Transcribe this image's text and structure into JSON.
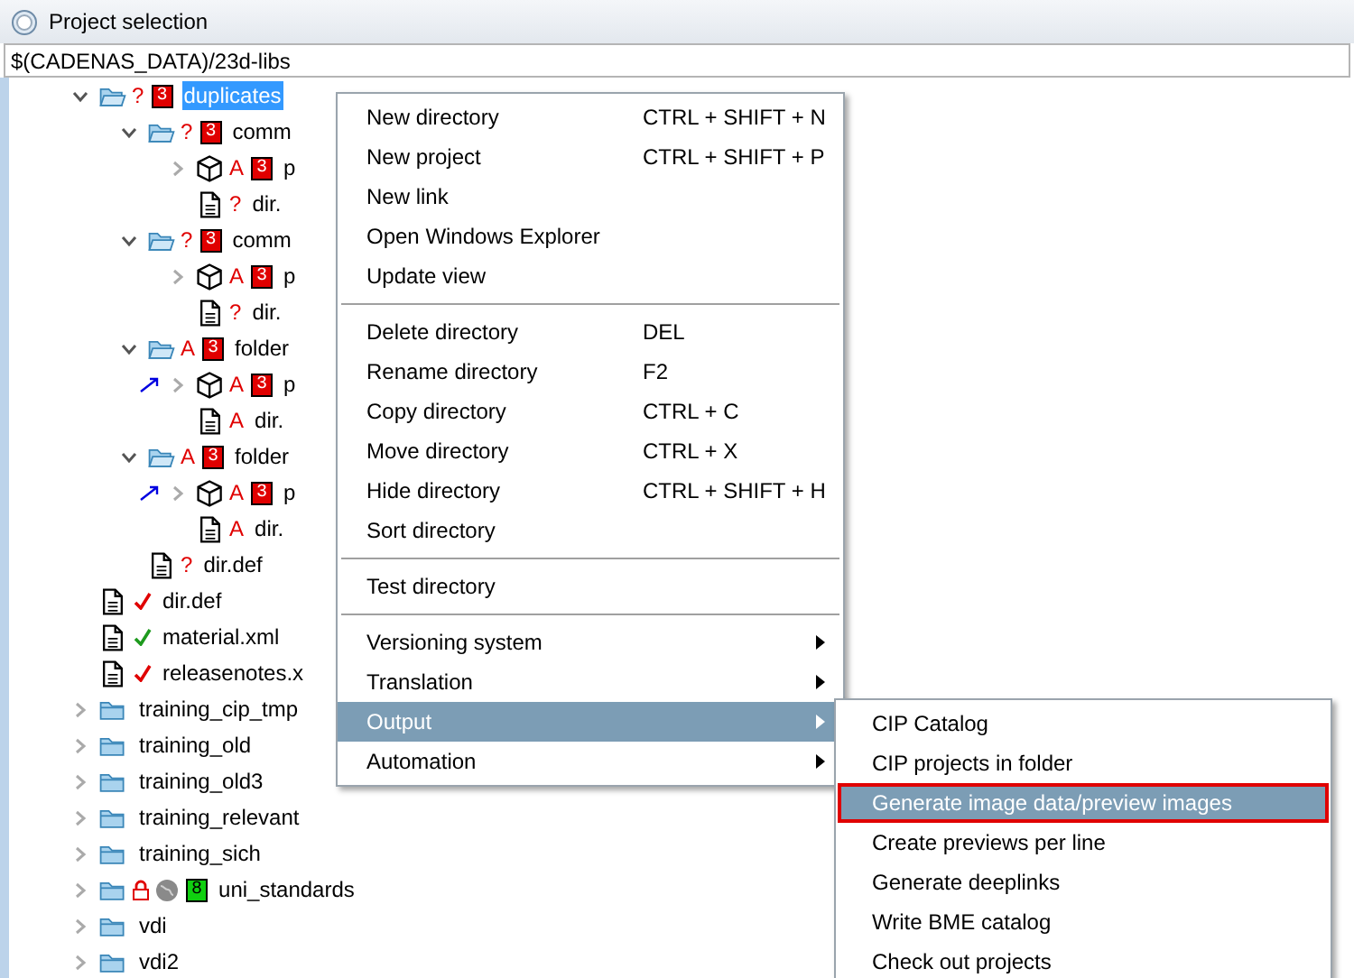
{
  "window": {
    "title": "Project selection"
  },
  "path_field": {
    "value": "$(CADENAS_DATA)/23d-libs"
  },
  "tree": [
    {
      "children": [
        {
          "label": "duplicates",
          "kind": "folder",
          "expanded": true,
          "selected": true,
          "marker": "?",
          "badge": {
            "text": "3",
            "color": "#e00000"
          },
          "children": [
            {
              "label": "comm",
              "kind": "folder",
              "expanded": true,
              "selected": false,
              "marker": "?",
              "badge": {
                "text": "3",
                "color": "#e00000"
              },
              "children": [
                {
                  "label": "p",
                  "kind": "project",
                  "expanded": false,
                  "selected": false,
                  "marker": "A",
                  "badge": {
                    "text": "3",
                    "color": "#e00000"
                  }
                },
                {
                  "label": "dir.",
                  "kind": "file",
                  "selected": false,
                  "marker": "?"
                }
              ]
            },
            {
              "label": "comm",
              "kind": "folder",
              "expanded": true,
              "selected": false,
              "marker": "?",
              "badge": {
                "text": "3",
                "color": "#e00000"
              },
              "children": [
                {
                  "label": "p",
                  "kind": "project",
                  "expanded": false,
                  "selected": false,
                  "marker": "A",
                  "badge": {
                    "text": "3",
                    "color": "#e00000"
                  }
                },
                {
                  "label": "dir.",
                  "kind": "file",
                  "selected": false,
                  "marker": "?"
                }
              ]
            },
            {
              "label": "folder",
              "kind": "folder",
              "expanded": true,
              "selected": false,
              "marker": "A",
              "badge": {
                "text": "3",
                "color": "#e00000"
              },
              "children": [
                {
                  "label": "p",
                  "kind": "project",
                  "expanded": false,
                  "selected": false,
                  "linked": true,
                  "marker": "A",
                  "badge": {
                    "text": "3",
                    "color": "#e00000"
                  }
                },
                {
                  "label": "dir.",
                  "kind": "file",
                  "selected": false,
                  "marker": "A"
                }
              ]
            },
            {
              "label": "folder",
              "kind": "folder",
              "expanded": true,
              "selected": false,
              "marker": "A",
              "badge": {
                "text": "3",
                "color": "#e00000"
              },
              "children": [
                {
                  "label": "p",
                  "kind": "project",
                  "expanded": false,
                  "selected": false,
                  "linked": true,
                  "marker": "A",
                  "badge": {
                    "text": "3",
                    "color": "#e00000"
                  }
                },
                {
                  "label": "dir.",
                  "kind": "file",
                  "selected": false,
                  "marker": "A"
                }
              ]
            },
            {
              "label": "dir.def",
              "kind": "file",
              "selected": false,
              "marker": "?"
            }
          ]
        },
        {
          "label": "dir.def",
          "kind": "file",
          "selected": false,
          "color": "#e00000"
        },
        {
          "label": "material.xml",
          "kind": "file",
          "selected": false,
          "color": "#1e9a1e"
        },
        {
          "label": "releasenotes.x",
          "kind": "file",
          "selected": false,
          "color": "#e00000"
        }
      ]
    },
    {
      "label": "training_cip_tmp",
      "kind": "folder",
      "expanded": false,
      "selected": false
    },
    {
      "label": "training_old",
      "kind": "folder",
      "expanded": false,
      "selected": false
    },
    {
      "label": "training_old3",
      "kind": "folder",
      "expanded": false,
      "selected": false
    },
    {
      "label": "training_relevant",
      "kind": "folder",
      "expanded": false,
      "selected": false
    },
    {
      "label": "training_sich",
      "kind": "folder",
      "expanded": false,
      "selected": false
    },
    {
      "label": "uni_standards",
      "kind": "folder",
      "expanded": false,
      "selected": false,
      "locked": true,
      "online": true,
      "badge": {
        "text": "8",
        "color": "#10d010"
      }
    },
    {
      "label": "vdi",
      "kind": "folder",
      "expanded": false,
      "selected": false
    },
    {
      "label": "vdi2",
      "kind": "folder",
      "expanded": false,
      "selected": false
    }
  ],
  "context_menu": [
    {
      "kind": "item",
      "label": "New directory",
      "shortcut": "CTRL + SHIFT + N",
      "submenu": false,
      "selected": false
    },
    {
      "kind": "item",
      "label": "New project",
      "shortcut": "CTRL + SHIFT + P",
      "submenu": false,
      "selected": false
    },
    {
      "kind": "item",
      "label": "New link",
      "submenu": false,
      "selected": false
    },
    {
      "kind": "item",
      "label": "Open Windows Explorer",
      "submenu": false,
      "selected": false
    },
    {
      "kind": "item",
      "label": "Update view",
      "submenu": false,
      "selected": false
    },
    {
      "kind": "separator"
    },
    {
      "kind": "item",
      "label": "Delete directory",
      "shortcut": "DEL",
      "submenu": false,
      "selected": false
    },
    {
      "kind": "item",
      "label": "Rename directory",
      "shortcut": "F2",
      "submenu": false,
      "selected": false
    },
    {
      "kind": "item",
      "label": "Copy directory",
      "shortcut": "CTRL + C",
      "submenu": false,
      "selected": false
    },
    {
      "kind": "item",
      "label": "Move directory",
      "shortcut": "CTRL + X",
      "submenu": false,
      "selected": false
    },
    {
      "kind": "item",
      "label": "Hide directory",
      "shortcut": "CTRL + SHIFT + H",
      "submenu": false,
      "selected": false
    },
    {
      "kind": "item",
      "label": "Sort directory",
      "submenu": false,
      "selected": false
    },
    {
      "kind": "separator"
    },
    {
      "kind": "item",
      "label": "Test directory",
      "submenu": false,
      "selected": false
    },
    {
      "kind": "separator"
    },
    {
      "kind": "item",
      "label": "Versioning system",
      "submenu": true,
      "selected": false
    },
    {
      "kind": "item",
      "label": "Translation",
      "submenu": true,
      "selected": false
    },
    {
      "kind": "item",
      "label": "Output",
      "submenu": true,
      "selected": true
    },
    {
      "kind": "item",
      "label": "Automation",
      "submenu": true,
      "selected": false
    }
  ],
  "submenu": [
    {
      "label": "CIP Catalog",
      "selected": false,
      "annotated": false
    },
    {
      "label": "CIP projects in folder",
      "selected": false,
      "annotated": false
    },
    {
      "label": "Generate image data/preview images",
      "selected": true,
      "annotated": true
    },
    {
      "label": "Create previews per line",
      "selected": false,
      "annotated": false
    },
    {
      "label": "Generate deeplinks",
      "selected": false,
      "annotated": false
    },
    {
      "label": "Write BME catalog",
      "selected": false,
      "annotated": false
    },
    {
      "label": "Check out projects",
      "selected": false,
      "annotated": false
    }
  ]
}
